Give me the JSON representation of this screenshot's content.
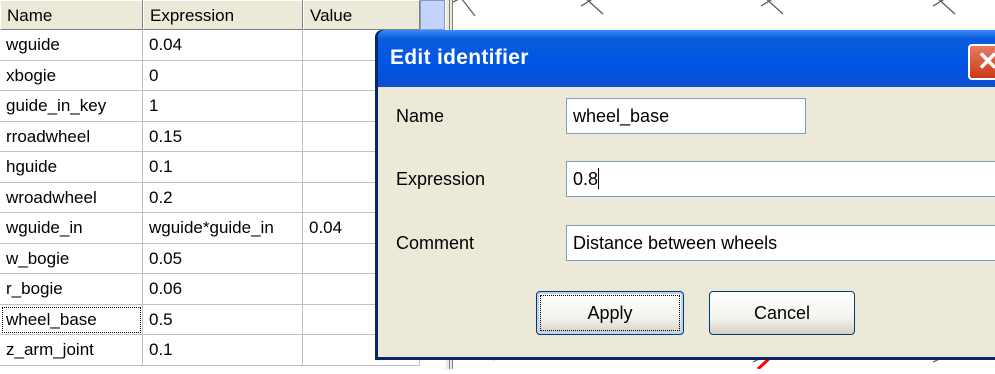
{
  "table": {
    "columns": [
      "Name",
      "Expression",
      "Value"
    ],
    "rows": [
      {
        "name": "wguide",
        "expression": "0.04",
        "value": ""
      },
      {
        "name": "xbogie",
        "expression": "0",
        "value": ""
      },
      {
        "name": "guide_in_key",
        "expression": "1",
        "value": ""
      },
      {
        "name": "rroadwheel",
        "expression": "0.15",
        "value": ""
      },
      {
        "name": "hguide",
        "expression": "0.1",
        "value": ""
      },
      {
        "name": "wroadwheel",
        "expression": "0.2",
        "value": ""
      },
      {
        "name": "wguide_in",
        "expression": "wguide*guide_in",
        "value": "0.04"
      },
      {
        "name": "w_bogie",
        "expression": "0.05",
        "value": ""
      },
      {
        "name": "r_bogie",
        "expression": "0.06",
        "value": ""
      },
      {
        "name": "wheel_base",
        "expression": "0.5",
        "value": ""
      },
      {
        "name": "z_arm_joint",
        "expression": "0.1",
        "value": ""
      }
    ]
  },
  "dialog": {
    "title": "Edit identifier",
    "close_glyph": "✕",
    "name_label": "Name",
    "name_value": "wheel_base",
    "expression_label": "Expression",
    "expression_value": "0.8",
    "comment_label": "Comment",
    "comment_value": "Distance between wheels",
    "apply_label": "Apply",
    "cancel_label": "Cancel"
  },
  "colors": {
    "titlebar": "#0055e5",
    "dialog_face": "#ece9d8",
    "close_button": "#c93a17",
    "canvas_red_mark": "#ff0000"
  }
}
